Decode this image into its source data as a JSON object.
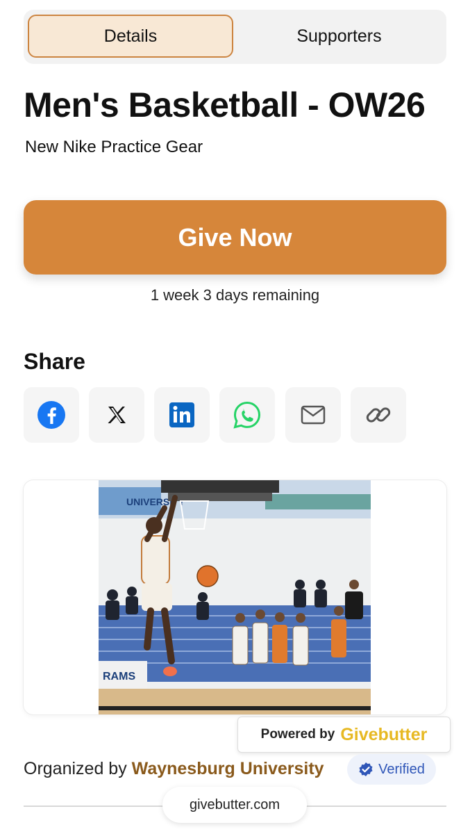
{
  "tabs": {
    "details": "Details",
    "supporters": "Supporters"
  },
  "campaign": {
    "title": "Men's Basketball - OW26",
    "subtitle": "New Nike Practice Gear",
    "give_label": "Give Now",
    "remaining": "1 week 3 days remaining"
  },
  "share": {
    "heading": "Share",
    "items": [
      {
        "name": "facebook-icon",
        "color": "#1877f2"
      },
      {
        "name": "x-icon",
        "color": "#111111"
      },
      {
        "name": "linkedin-icon",
        "color": "#0a66c2"
      },
      {
        "name": "whatsapp-icon",
        "color": "#25d366"
      },
      {
        "name": "email-icon",
        "color": "#555555"
      },
      {
        "name": "link-icon",
        "color": "#555555"
      }
    ]
  },
  "photo": {
    "sign_text": "UNIVERSITY",
    "banner_text": "RAMS"
  },
  "powered_by": {
    "label": "Powered by",
    "brand": "Givebutter"
  },
  "organizer": {
    "prefix": "Organized by",
    "name": "Waynesburg University",
    "verified": "Verified"
  },
  "footer": {
    "domain": "givebutter.com"
  },
  "colors": {
    "accent": "#d6863a",
    "brand_yellow": "#e7b923",
    "organizer": "#8a5a1c",
    "verified": "#2f56b8"
  }
}
